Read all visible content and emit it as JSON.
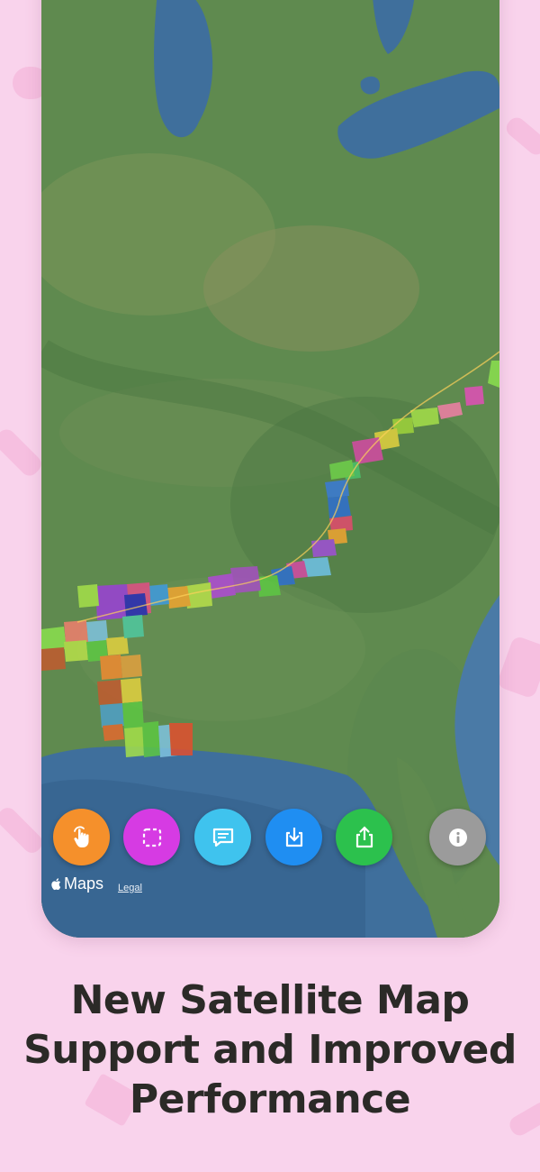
{
  "map": {
    "provider_label": "Maps",
    "legal_label": "Legal"
  },
  "toolbar": {
    "buttons": [
      {
        "name": "touch-tool-button",
        "icon": "hand-pointer-icon",
        "color": "#f5902b"
      },
      {
        "name": "select-region-button",
        "icon": "dashed-square-icon",
        "color": "#d63be3"
      },
      {
        "name": "comment-button",
        "icon": "speech-bubble-icon",
        "color": "#3fc3ee"
      },
      {
        "name": "download-button",
        "icon": "download-tray-icon",
        "color": "#1f8ef2"
      },
      {
        "name": "share-button",
        "icon": "share-upload-icon",
        "color": "#2cc14d"
      },
      {
        "name": "info-button",
        "icon": "info-icon",
        "color": "#9b9b9b"
      }
    ]
  },
  "headline": {
    "line1": "New Satellite Map",
    "line2": "Support and Improved",
    "line3": "Performance"
  },
  "colors": {
    "background": "#f9d3ec",
    "text": "#2b2a27",
    "water": "#3f6f9c",
    "land": "#5f8a4f"
  }
}
